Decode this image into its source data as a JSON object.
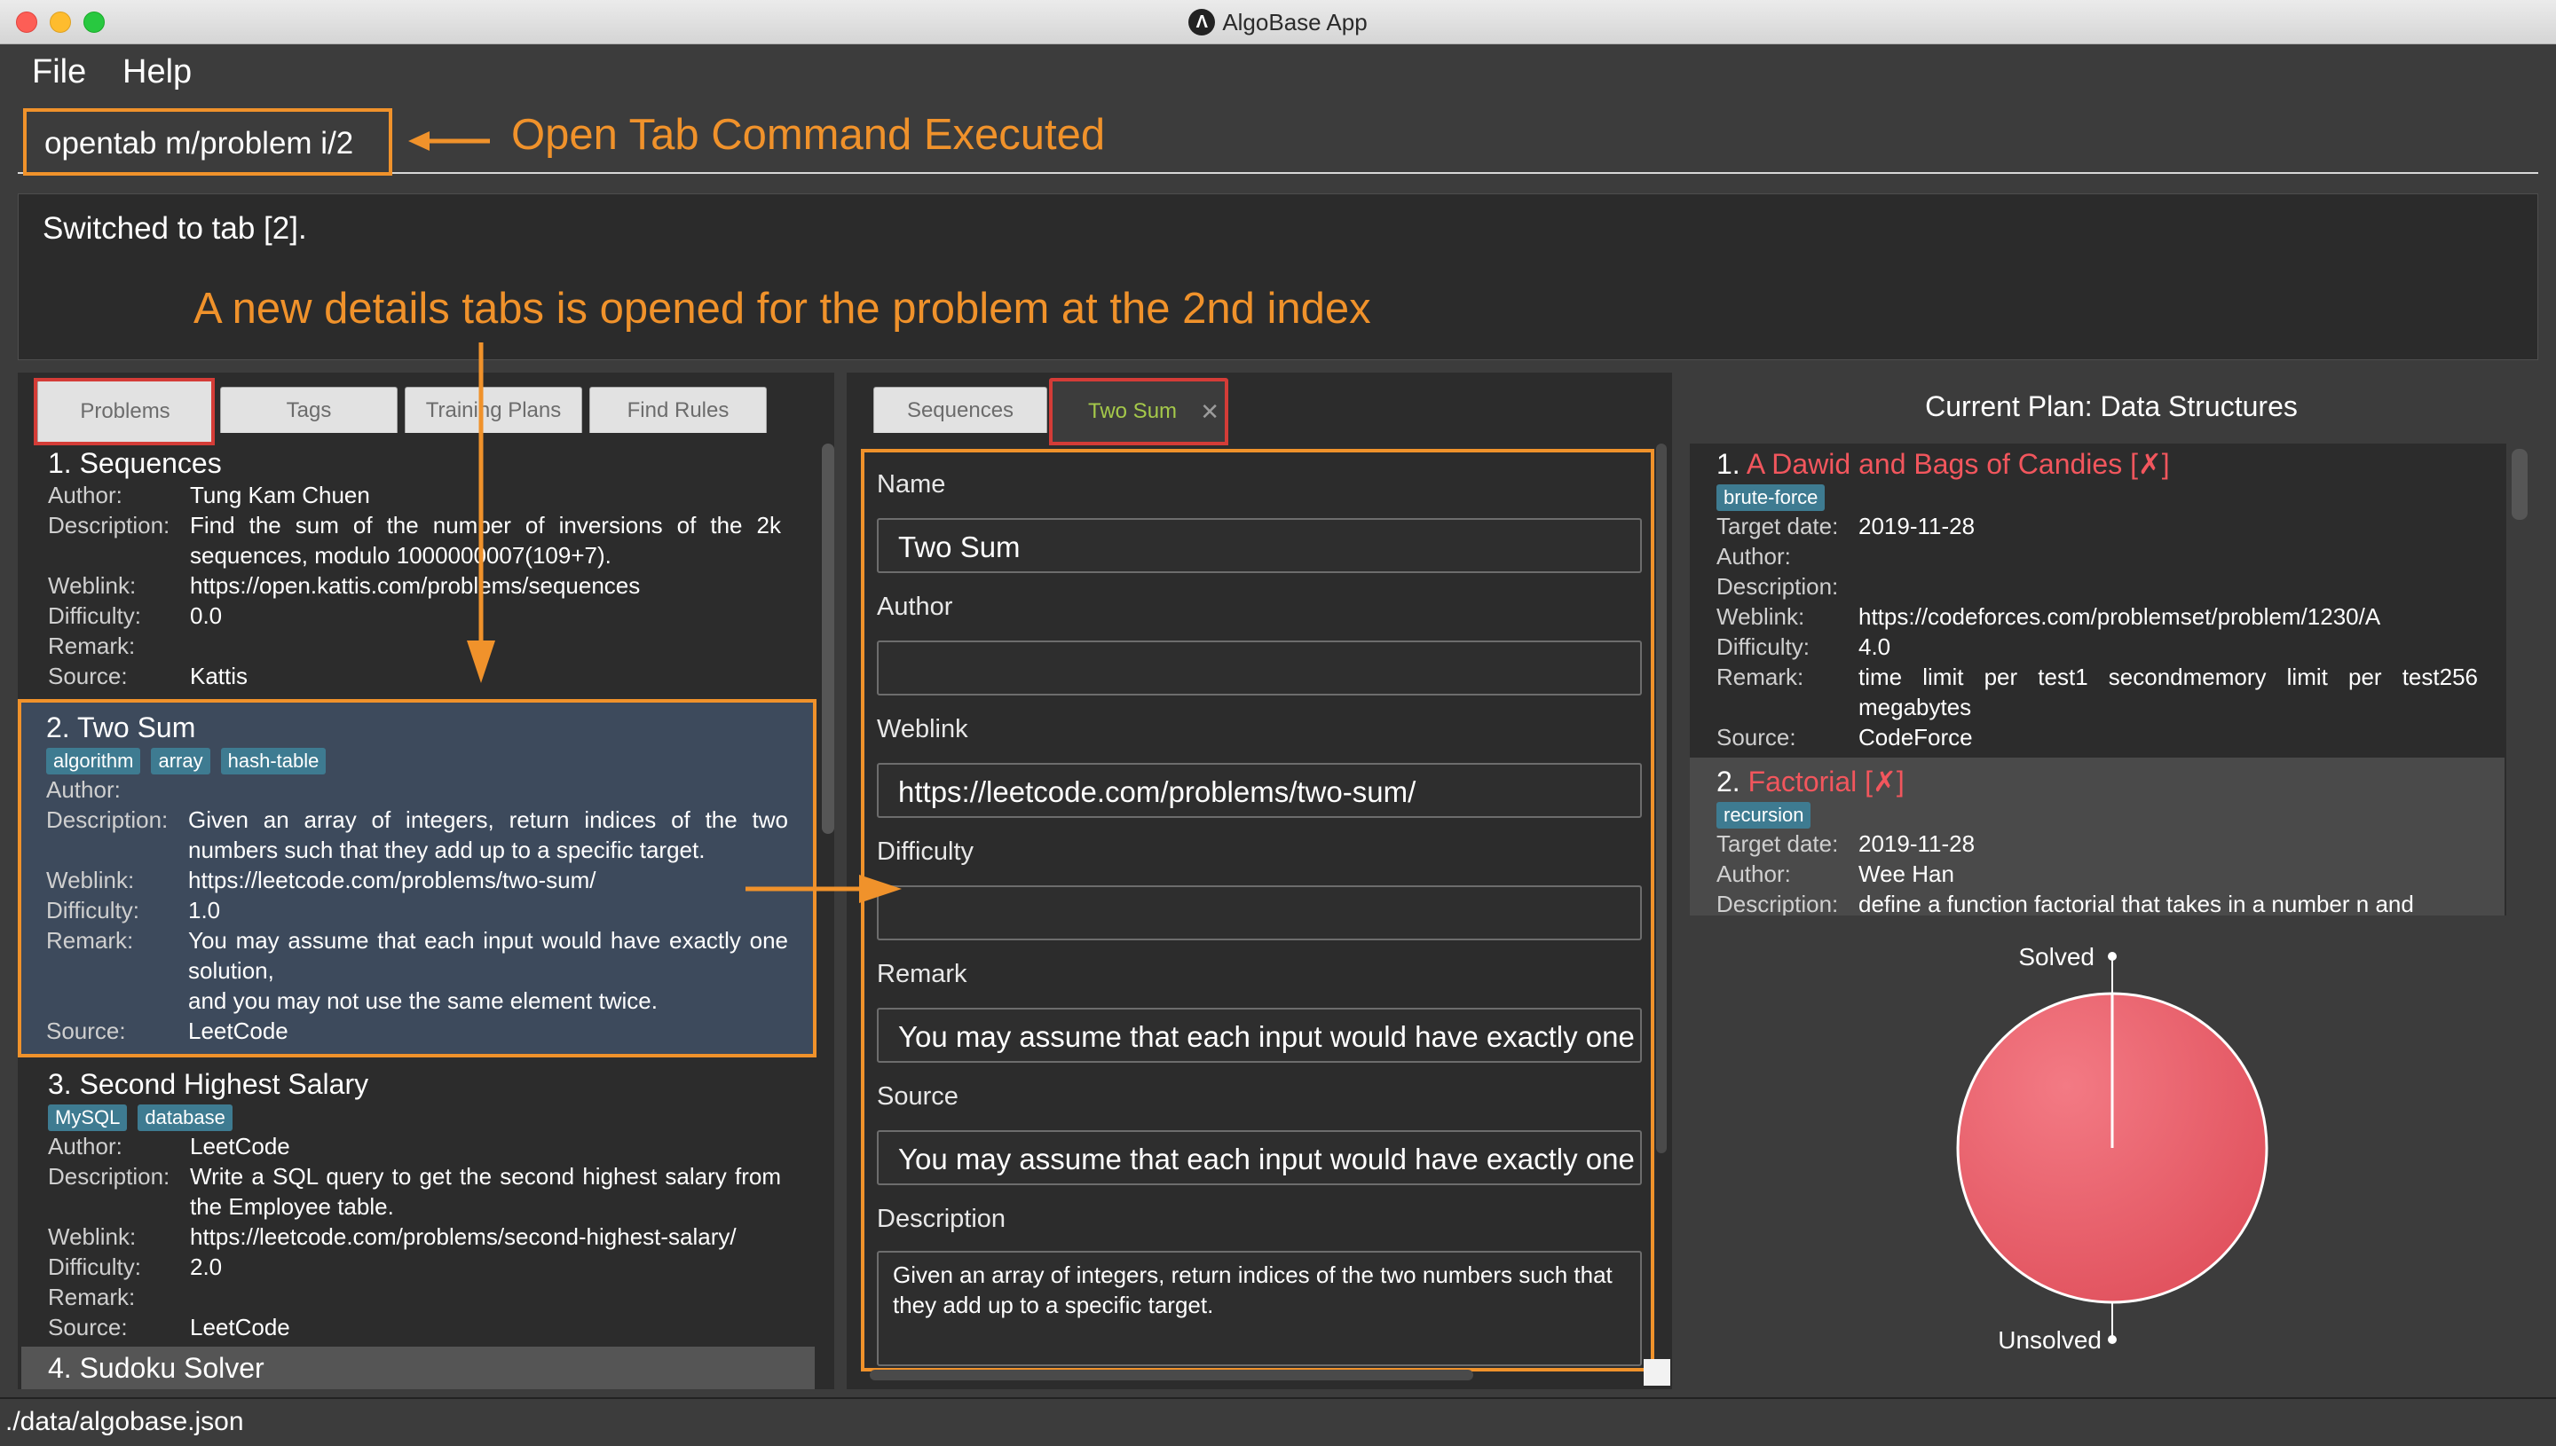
{
  "window": {
    "title": "AlgoBase App",
    "logo_glyph": "Λ"
  },
  "menu": {
    "file": "File",
    "help": "Help"
  },
  "command": {
    "value": "opentab m/problem i/2"
  },
  "annotations": {
    "command": "Open Tab Command Executed",
    "details": "A new details tabs is opened for the problem at the 2nd index",
    "color": "#f0922b"
  },
  "result": {
    "text": "Switched to tab [2]."
  },
  "left_tabs": [
    "Problems",
    "Tags",
    "Training Plans",
    "Find Rules"
  ],
  "middle_tabs": {
    "first": "Sequences",
    "second": "Two Sum",
    "close": "✕"
  },
  "labels": {
    "author": "Author:",
    "description": "Description:",
    "weblink": "Weblink:",
    "difficulty": "Difficulty:",
    "remark": "Remark:",
    "source": "Source:",
    "target_date": "Target date:"
  },
  "problems": [
    {
      "title": "1.  Sequences",
      "tags": [],
      "author": "Tung Kam Chuen",
      "description": "Find the sum of the number of inversions of the 2k sequences, modulo 1000000007(109+7).",
      "weblink": "https://open.kattis.com/problems/sequences",
      "difficulty": "0.0",
      "remark": "",
      "source": "Kattis"
    },
    {
      "title": "2.  Two Sum",
      "tags": [
        "algorithm",
        "array",
        "hash-table"
      ],
      "author": "",
      "description": "Given an array of integers, return indices of the two numbers such that they add up to a specific target.",
      "weblink": "https://leetcode.com/problems/two-sum/",
      "difficulty": "1.0",
      "remark_line1": "You may assume that each input would have exactly one solution,",
      "remark_line2": "and you may not use the same element twice.",
      "source": "LeetCode"
    },
    {
      "title": "3.  Second Highest Salary",
      "tags": [
        "MySQL",
        "database"
      ],
      "author": "LeetCode",
      "description": "Write a SQL query to get the second highest salary from the Employee table.",
      "weblink": "https://leetcode.com/problems/second-highest-salary/",
      "difficulty": "2.0",
      "remark": "",
      "source": "LeetCode"
    },
    {
      "title": "4.  Sudoku Solver"
    }
  ],
  "details_form": {
    "name_label": "Name",
    "name_value": "Two Sum",
    "author_label": "Author",
    "author_value": "",
    "weblink_label": "Weblink",
    "weblink_value": "https://leetcode.com/problems/two-sum/",
    "difficulty_label": "Difficulty",
    "difficulty_value": "",
    "remark_label": "Remark",
    "remark_value": "You may assume that each input would have exactly one solution,",
    "source_label": "Source",
    "source_value": "You may assume that each input would have exactly one solution,",
    "description_label": "Description",
    "description_value": "Given an array of integers, return indices of the two numbers such that they add up to a specific target."
  },
  "plan": {
    "header": "Current Plan: Data Structures",
    "tasks": [
      {
        "num": "1.",
        "title": "A Dawid and Bags of Candies",
        "mark": "[✗]",
        "tags": [
          "brute-force"
        ],
        "target_date": "2019-11-28",
        "author": "",
        "description": "",
        "weblink": "https://codeforces.com/problemset/problem/1230/A",
        "difficulty": "4.0",
        "remark": "time limit per test1 secondmemory limit per test256 megabytes",
        "source": "CodeForce"
      },
      {
        "num": "2.",
        "title": "Factorial",
        "mark": "[✗]",
        "tags": [
          "recursion"
        ],
        "target_date": "2019-11-28",
        "author": "Wee Han",
        "description": "define a function factorial that takes in a number n and"
      }
    ]
  },
  "pie": {
    "solved_label": "Solved",
    "unsolved_label": "Unsolved",
    "solved": 0,
    "unsolved": 1,
    "color": "#e8525e"
  },
  "status": {
    "path": "./data/algobase.json"
  }
}
